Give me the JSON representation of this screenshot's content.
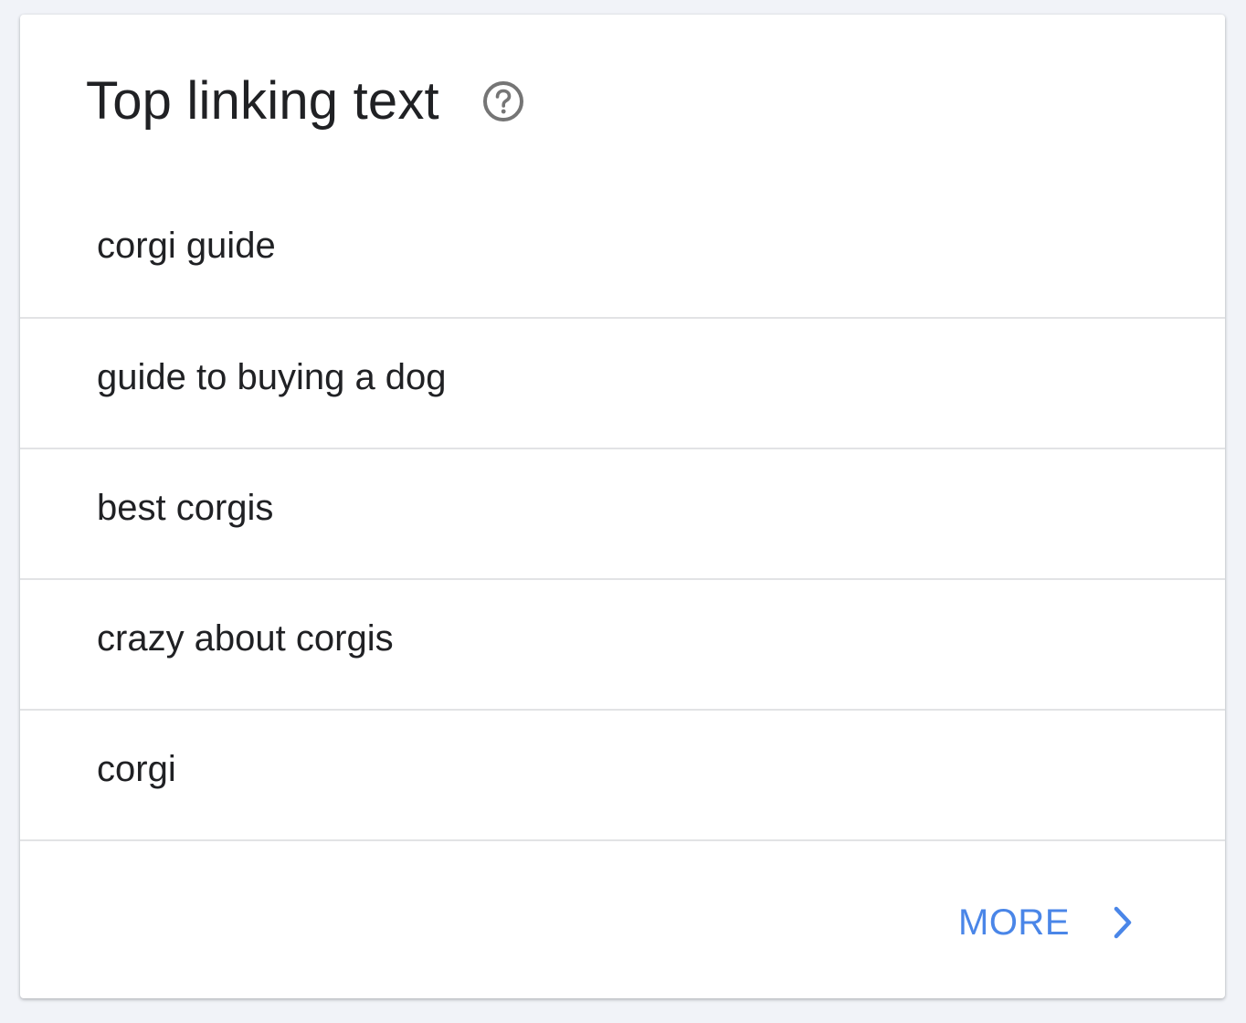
{
  "card": {
    "title": "Top linking text",
    "help_icon": "help-circle-icon",
    "items": [
      {
        "label": "corgi guide"
      },
      {
        "label": "guide to buying a dog"
      },
      {
        "label": "best corgis"
      },
      {
        "label": "crazy about corgis"
      },
      {
        "label": "corgi"
      }
    ],
    "more_label": "MORE",
    "more_icon": "chevron-right-icon"
  },
  "colors": {
    "background": "#f1f3f8",
    "card": "#ffffff",
    "text": "#202124",
    "divider": "#e2e3e5",
    "accent": "#4a86e8",
    "icon": "#757575"
  }
}
